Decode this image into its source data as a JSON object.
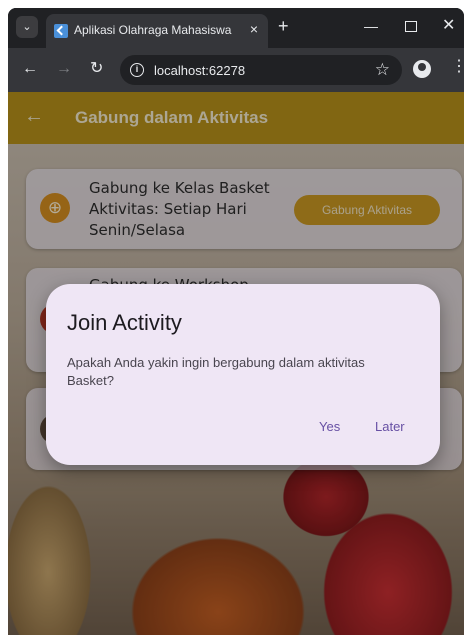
{
  "browser": {
    "tab_title": "Aplikasi Olahraga Mahasiswa",
    "tab_close": "×",
    "new_tab": "+",
    "url": "localhost:62278",
    "icons": {
      "tab_menu": "chevron-down-icon",
      "favicon": "flutter-icon",
      "back": "arrow-left-icon",
      "forward": "arrow-right-icon",
      "reload": "reload-icon",
      "info": "info-icon",
      "star": "star-icon",
      "profile": "profile-icon",
      "menu": "kebab-icon"
    }
  },
  "appbar": {
    "title": "Gabung dalam Aktivitas",
    "back_icon": "arrow-left-icon",
    "color": "#b58e12"
  },
  "cards": [
    {
      "text": "Gabung ke Kelas Basket Aktivitas: Setiap Hari Senin/Selasa",
      "button_label": "Gabung Aktivitas",
      "icon": "basketball-icon"
    },
    {
      "text": "Gabung ke Workshop"
    }
  ],
  "dialog": {
    "title": "Join Activity",
    "body": "Apakah Anda yakin ingin bergabung dalam aktivitas Basket?",
    "yes_label": "Yes",
    "later_label": "Later",
    "accent": "#6750a4"
  }
}
